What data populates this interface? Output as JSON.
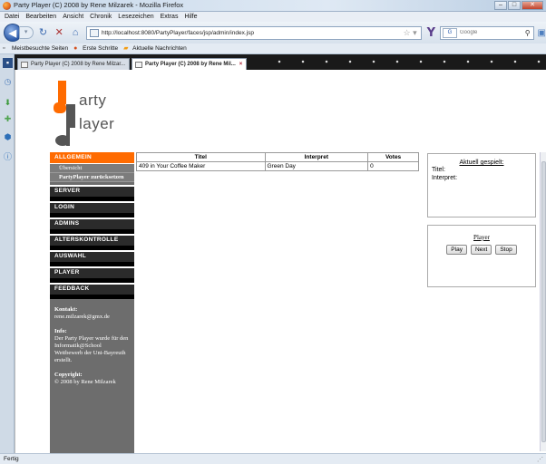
{
  "window": {
    "title": "Party Player (C) 2008 by Rene Milzarek - Mozilla Firefox",
    "min": "–",
    "max": "□",
    "close": "✕"
  },
  "menu": [
    "Datei",
    "Bearbeiten",
    "Ansicht",
    "Chronik",
    "Lesezeichen",
    "Extras",
    "Hilfe"
  ],
  "nav": {
    "url": "http://localhost:8080/PartyPlayer/faces/jsp/admin/index.jsp",
    "search_placeholder": "Google",
    "search_engine": "G"
  },
  "bookmarks": [
    "Meistbesuchte Seiten",
    "Erste Schritte",
    "Aktuelle Nachrichten"
  ],
  "tabs": [
    {
      "label": "Party Player (C) 2008 by Rene Milzar...",
      "active": false
    },
    {
      "label": "Party Player (C) 2008 by Rene Mil...",
      "active": true
    }
  ],
  "logo": {
    "line1": "arty",
    "line2": "layer"
  },
  "leftnav": {
    "head": "ALLGEMEIN",
    "sub": [
      "Übersicht",
      "PartyPlayer zurücksetzen"
    ],
    "sections": [
      "SERVER",
      "LOGIN",
      "ADMINS",
      "ALTERSKONTROLLE",
      "AUSWAHL",
      "PLAYER",
      "FEEDBACK"
    ],
    "contact_label": "Kontakt:",
    "contact_value": "rene.milzarek@gmx.de",
    "info_label": "Info:",
    "info_value": "Der Party Player wurde für den Informatik@School Wettbewerb der Uni-Bayreuth erstellt.",
    "copyright_label": "Copyright:",
    "copyright_value": "© 2008 by Rene Milzarek"
  },
  "table": {
    "headers": [
      "Titel",
      "Interpret",
      "Votes"
    ],
    "rows": [
      [
        "409 in Your Coffee Maker",
        "Green Day",
        "0"
      ]
    ]
  },
  "current": {
    "title": "Aktuell gespielt:",
    "titel_label": "Titel:",
    "interpret_label": "Interpret:"
  },
  "player": {
    "title": "Player",
    "play": "Play",
    "next": "Next",
    "stop": "Stop"
  },
  "status": "Fertig"
}
